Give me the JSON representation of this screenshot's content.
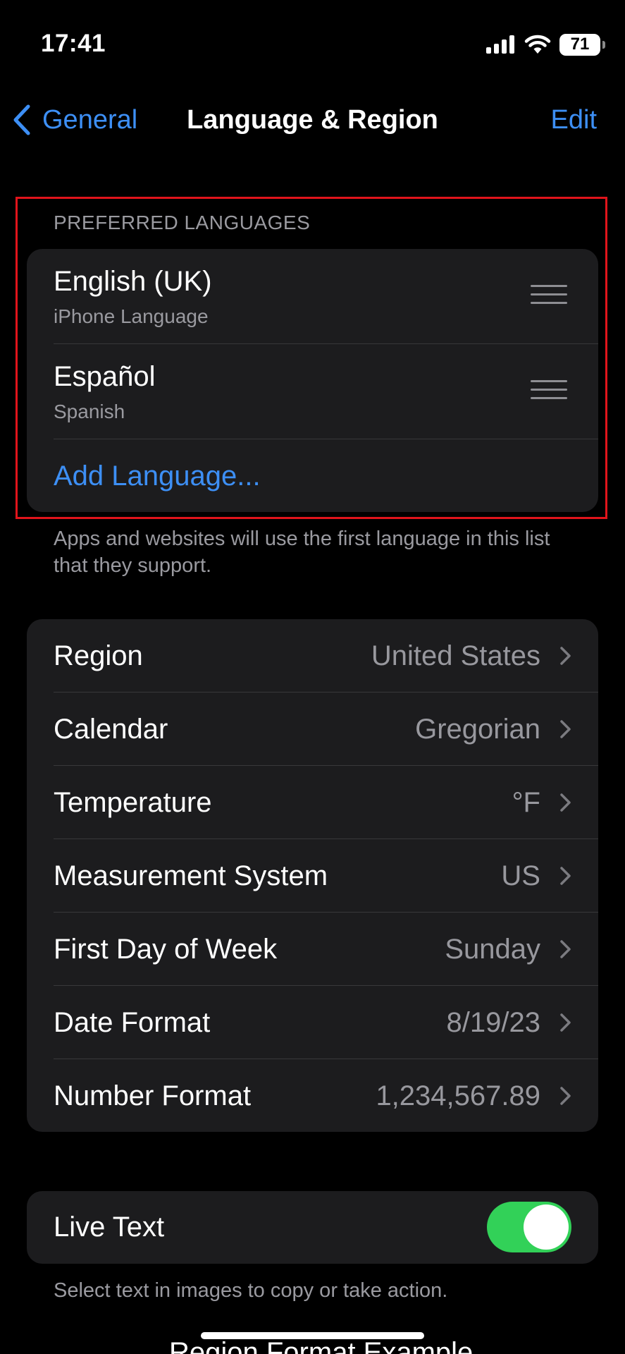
{
  "status_bar": {
    "time": "17:41",
    "battery": "71"
  },
  "nav": {
    "back_label": "General",
    "title": "Language & Region",
    "edit_label": "Edit"
  },
  "preferred_languages": {
    "header": "PREFERRED LANGUAGES",
    "items": [
      {
        "name": "English (UK)",
        "subtitle": "iPhone Language"
      },
      {
        "name": "Español",
        "subtitle": "Spanish"
      }
    ],
    "add_label": "Add Language...",
    "footnote": "Apps and websites will use the first language in this list that they support."
  },
  "region_settings": [
    {
      "label": "Region",
      "value": "United States"
    },
    {
      "label": "Calendar",
      "value": "Gregorian"
    },
    {
      "label": "Temperature",
      "value": "°F"
    },
    {
      "label": "Measurement System",
      "value": "US"
    },
    {
      "label": "First Day of Week",
      "value": "Sunday"
    },
    {
      "label": "Date Format",
      "value": "8/19/23"
    },
    {
      "label": "Number Format",
      "value": "1,234,567.89"
    }
  ],
  "live_text": {
    "label": "Live Text",
    "enabled": true,
    "footnote": "Select text in images to copy or take action."
  },
  "cut_off_text": "Region Format Example",
  "colors": {
    "accent": "#3d8ff5",
    "toggle_on": "#32d158",
    "highlight": "#e0141b",
    "card_bg": "#1c1c1e"
  }
}
